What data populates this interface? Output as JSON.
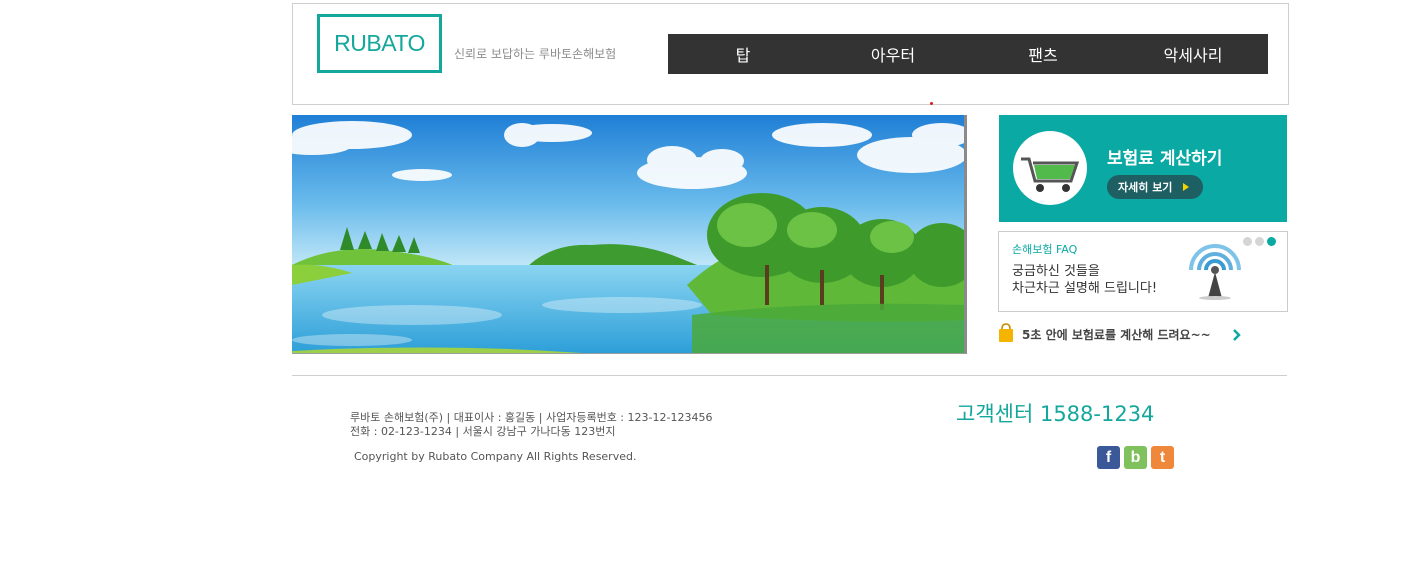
{
  "header": {
    "logo": "RUBATO",
    "tagline": "신뢰로 보답하는 루바토손해보험",
    "nav": [
      "탑",
      "아우터",
      "팬츠",
      "악세사리"
    ]
  },
  "sidebar": {
    "calc": {
      "title": "보험료 계산하기",
      "button_label": "자세히 보기",
      "color": "#0aa9a3"
    },
    "faq": {
      "title": "손해보험 FAQ",
      "line1": "궁금하신 것들을",
      "line2": "차근차근 설명해 드립니다!"
    },
    "promo": {
      "text": "5초 안에 보험료를 계산해 드려요~~"
    }
  },
  "footer": {
    "info_line1": "루바토 손해보험(주) | 대표이사 : 홍길동 | 사업자등록번호 : 123-12-123456",
    "info_line2": "전화 : 02-123-1234 | 서울시 강남구 가나다동 123번지",
    "copyright": "Copyright by Rubato Company All Rights Reserved.",
    "customer_center": "고객센터 1588-1234",
    "sns": [
      {
        "label": "f",
        "icon": "facebook-icon",
        "color": "#3b5998"
      },
      {
        "label": "b",
        "icon": "blog-icon",
        "color": "#7fc15d"
      },
      {
        "label": "t",
        "icon": "twitter-icon",
        "color": "#f0883c"
      }
    ]
  },
  "colors": {
    "accent": "#14a79c",
    "nav_bg": "#333333"
  }
}
